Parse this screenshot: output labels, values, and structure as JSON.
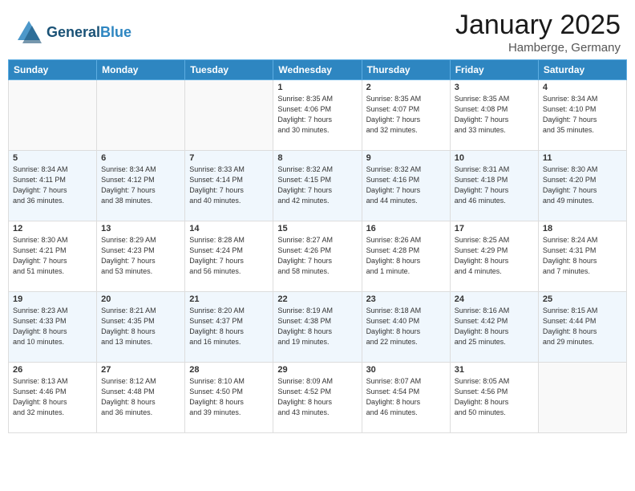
{
  "header": {
    "logo_line1": "General",
    "logo_line2": "Blue",
    "month": "January 2025",
    "location": "Hamberge, Germany"
  },
  "weekdays": [
    "Sunday",
    "Monday",
    "Tuesday",
    "Wednesday",
    "Thursday",
    "Friday",
    "Saturday"
  ],
  "weeks": [
    [
      {
        "day": "",
        "text": ""
      },
      {
        "day": "",
        "text": ""
      },
      {
        "day": "",
        "text": ""
      },
      {
        "day": "1",
        "text": "Sunrise: 8:35 AM\nSunset: 4:06 PM\nDaylight: 7 hours\nand 30 minutes."
      },
      {
        "day": "2",
        "text": "Sunrise: 8:35 AM\nSunset: 4:07 PM\nDaylight: 7 hours\nand 32 minutes."
      },
      {
        "day": "3",
        "text": "Sunrise: 8:35 AM\nSunset: 4:08 PM\nDaylight: 7 hours\nand 33 minutes."
      },
      {
        "day": "4",
        "text": "Sunrise: 8:34 AM\nSunset: 4:10 PM\nDaylight: 7 hours\nand 35 minutes."
      }
    ],
    [
      {
        "day": "5",
        "text": "Sunrise: 8:34 AM\nSunset: 4:11 PM\nDaylight: 7 hours\nand 36 minutes."
      },
      {
        "day": "6",
        "text": "Sunrise: 8:34 AM\nSunset: 4:12 PM\nDaylight: 7 hours\nand 38 minutes."
      },
      {
        "day": "7",
        "text": "Sunrise: 8:33 AM\nSunset: 4:14 PM\nDaylight: 7 hours\nand 40 minutes."
      },
      {
        "day": "8",
        "text": "Sunrise: 8:32 AM\nSunset: 4:15 PM\nDaylight: 7 hours\nand 42 minutes."
      },
      {
        "day": "9",
        "text": "Sunrise: 8:32 AM\nSunset: 4:16 PM\nDaylight: 7 hours\nand 44 minutes."
      },
      {
        "day": "10",
        "text": "Sunrise: 8:31 AM\nSunset: 4:18 PM\nDaylight: 7 hours\nand 46 minutes."
      },
      {
        "day": "11",
        "text": "Sunrise: 8:30 AM\nSunset: 4:20 PM\nDaylight: 7 hours\nand 49 minutes."
      }
    ],
    [
      {
        "day": "12",
        "text": "Sunrise: 8:30 AM\nSunset: 4:21 PM\nDaylight: 7 hours\nand 51 minutes."
      },
      {
        "day": "13",
        "text": "Sunrise: 8:29 AM\nSunset: 4:23 PM\nDaylight: 7 hours\nand 53 minutes."
      },
      {
        "day": "14",
        "text": "Sunrise: 8:28 AM\nSunset: 4:24 PM\nDaylight: 7 hours\nand 56 minutes."
      },
      {
        "day": "15",
        "text": "Sunrise: 8:27 AM\nSunset: 4:26 PM\nDaylight: 7 hours\nand 58 minutes."
      },
      {
        "day": "16",
        "text": "Sunrise: 8:26 AM\nSunset: 4:28 PM\nDaylight: 8 hours\nand 1 minute."
      },
      {
        "day": "17",
        "text": "Sunrise: 8:25 AM\nSunset: 4:29 PM\nDaylight: 8 hours\nand 4 minutes."
      },
      {
        "day": "18",
        "text": "Sunrise: 8:24 AM\nSunset: 4:31 PM\nDaylight: 8 hours\nand 7 minutes."
      }
    ],
    [
      {
        "day": "19",
        "text": "Sunrise: 8:23 AM\nSunset: 4:33 PM\nDaylight: 8 hours\nand 10 minutes."
      },
      {
        "day": "20",
        "text": "Sunrise: 8:21 AM\nSunset: 4:35 PM\nDaylight: 8 hours\nand 13 minutes."
      },
      {
        "day": "21",
        "text": "Sunrise: 8:20 AM\nSunset: 4:37 PM\nDaylight: 8 hours\nand 16 minutes."
      },
      {
        "day": "22",
        "text": "Sunrise: 8:19 AM\nSunset: 4:38 PM\nDaylight: 8 hours\nand 19 minutes."
      },
      {
        "day": "23",
        "text": "Sunrise: 8:18 AM\nSunset: 4:40 PM\nDaylight: 8 hours\nand 22 minutes."
      },
      {
        "day": "24",
        "text": "Sunrise: 8:16 AM\nSunset: 4:42 PM\nDaylight: 8 hours\nand 25 minutes."
      },
      {
        "day": "25",
        "text": "Sunrise: 8:15 AM\nSunset: 4:44 PM\nDaylight: 8 hours\nand 29 minutes."
      }
    ],
    [
      {
        "day": "26",
        "text": "Sunrise: 8:13 AM\nSunset: 4:46 PM\nDaylight: 8 hours\nand 32 minutes."
      },
      {
        "day": "27",
        "text": "Sunrise: 8:12 AM\nSunset: 4:48 PM\nDaylight: 8 hours\nand 36 minutes."
      },
      {
        "day": "28",
        "text": "Sunrise: 8:10 AM\nSunset: 4:50 PM\nDaylight: 8 hours\nand 39 minutes."
      },
      {
        "day": "29",
        "text": "Sunrise: 8:09 AM\nSunset: 4:52 PM\nDaylight: 8 hours\nand 43 minutes."
      },
      {
        "day": "30",
        "text": "Sunrise: 8:07 AM\nSunset: 4:54 PM\nDaylight: 8 hours\nand 46 minutes."
      },
      {
        "day": "31",
        "text": "Sunrise: 8:05 AM\nSunset: 4:56 PM\nDaylight: 8 hours\nand 50 minutes."
      },
      {
        "day": "",
        "text": ""
      }
    ]
  ]
}
